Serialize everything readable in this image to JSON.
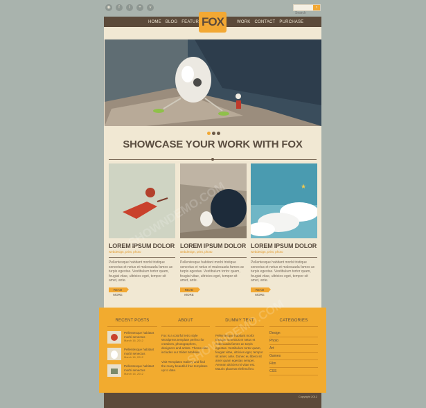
{
  "social": {
    "icons": [
      "rss-icon",
      "facebook-icon",
      "twitter-icon",
      "google-plus-icon",
      "vimeo-icon"
    ]
  },
  "search": {
    "placeholder": "Search"
  },
  "nav": {
    "left": [
      "HOME",
      "BLOG",
      "FEATURES"
    ],
    "right": [
      "WORK",
      "CONTACT",
      "PURCHASE"
    ]
  },
  "logo": {
    "text": "FOX"
  },
  "slider": {
    "active_dot": 0,
    "dot_count": 3
  },
  "headline": "SHOWCASE YOUR WORK WITH FOX",
  "cards": [
    {
      "title": "LOREM IPSUM DOLOR",
      "meta": "webdesign, print, photo",
      "desc": "Pellentesque habitant morbi tristique senectus et netus et malesuada fames ac turpis egestas. Vestibulum tortor quam, feugiat vitae, ultricies eget, tempor sit amet, ante.",
      "more": "READ MORE"
    },
    {
      "title": "LOREM IPSUM DOLOR",
      "meta": "webdesign, print, photo",
      "desc": "Pellentesque habitant morbi tristique senectus et netus et malesuada fames ac turpis egestas. Vestibulum tortor quam, feugiat vitae, ultricies eget, tempor sit amet, ante.",
      "more": "READ MORE"
    },
    {
      "title": "LOREM IPSUM DOLOR",
      "meta": "webdesign, print, photo",
      "desc": "Pellentesque habitant morbi tristique senectus et netus et malesuada fames ac turpis egestas. Vestibulum tortor quam, feugiat vitae, ultricies eget, tempor sit amet, ante.",
      "more": "READ MORE"
    }
  ],
  "footer": {
    "recent_posts_title": "RECENT POSTS",
    "posts": [
      {
        "text": "Pellentesque habitant morbi senectus",
        "date": "March 16, 2012"
      },
      {
        "text": "Pellentesque habitant morbi senectus",
        "date": "March 16, 2012"
      },
      {
        "text": "Pellentesque habitant morbi senectus",
        "date": "March 16, 2012"
      }
    ],
    "about_title": "ABOUT",
    "about_text1": "Fox is a colorful retro style Wordpress template perfect for creatives, photographers, designers and artists. Theme also includes our Slider Modules.",
    "about_text2": "Visit Templates Gallery and find the many beautiful free templates up to date.",
    "dummy_title": "DUMMY TEXT",
    "dummy_text": "Pellentesque habitant morbi tristique senectus et netus et malesuada fames ac turpis egestas. Vestibulum tortor quam, feugiat vitae, ultricies eget, tempor sit amet, ante. Donec eu libero sit amet quam egestas semper. Aenean ultricies mi vitae est. Mauris placerat eleifend leo.",
    "categories_title": "CATEGORIES",
    "categories": [
      "Design",
      "Photo",
      "Art",
      "Games",
      "Film",
      "CSS"
    ]
  },
  "bottom": {
    "copy": "Copyright 2012"
  },
  "watermark": "SHOWNDEMO.COM",
  "colors": {
    "accent": "#f2a833",
    "brown": "#5c4a3a",
    "cream": "#f1e8d3",
    "background": "#a9b3ad"
  }
}
